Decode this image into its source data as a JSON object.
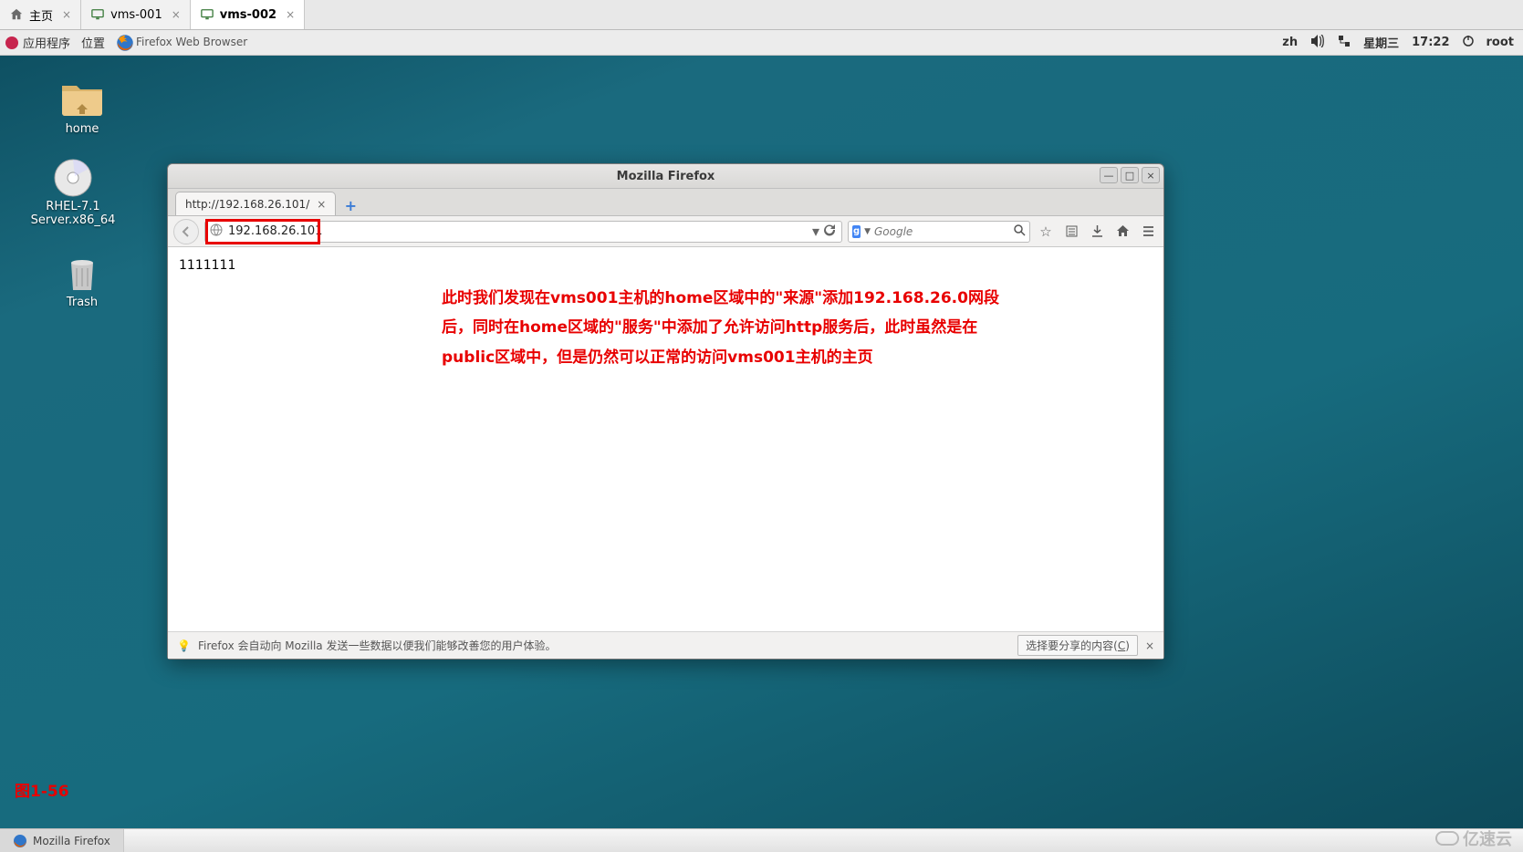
{
  "vm_tabs": [
    {
      "label": "主页",
      "icon": "home",
      "active": false
    },
    {
      "label": "vms-001",
      "icon": "monitor",
      "active": false
    },
    {
      "label": "vms-002",
      "icon": "monitor",
      "active": true
    }
  ],
  "gnome": {
    "apps": "应用程序",
    "places": "位置",
    "active_app": "Firefox Web Browser",
    "lang": "zh",
    "day": "星期三",
    "time": "17:22",
    "user": "root"
  },
  "desktop_icons": {
    "home": "home",
    "disc": "RHEL-7.1 Server.x86_64",
    "trash": "Trash"
  },
  "firefox": {
    "title": "Mozilla Firefox",
    "tab_label": "http://192.168.26.101/",
    "url": "192.168.26.101",
    "search_placeholder": "Google",
    "page_text": "1111111",
    "annotation": "此时我们发现在vms001主机的home区域中的\"来源\"添加192.168.26.0网段后，同时在home区域的\"服务\"中添加了允许访问http服务后，此时虽然是在public区域中，但是仍然可以正常的访问vms001主机的主页",
    "footer_msg": "Firefox 会自动向 Mozilla 发送一些数据以便我们能够改善您的用户体验。",
    "share_btn_pre": "选择要分享的内容(",
    "share_btn_key": "C",
    "share_btn_post": ")"
  },
  "figure_caption": "图1-56",
  "taskbar": {
    "firefox": "Mozilla Firefox"
  },
  "watermark": "亿速云"
}
